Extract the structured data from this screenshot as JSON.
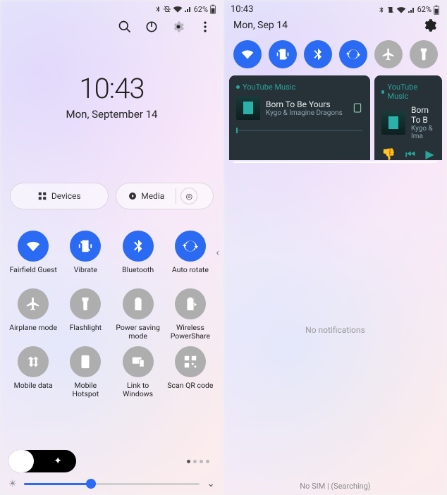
{
  "left": {
    "status": {
      "battery_pct": "62%"
    },
    "clock": {
      "time": "10:43",
      "date": "Mon, September 14"
    },
    "chips": {
      "devices": "Devices",
      "media": "Media"
    },
    "qs": [
      {
        "key": "wifi",
        "label": "Fairfield Guest",
        "on": true
      },
      {
        "key": "vibrate",
        "label": "Vibrate",
        "on": true
      },
      {
        "key": "bluetooth",
        "label": "Bluetooth",
        "on": true
      },
      {
        "key": "autorotate",
        "label": "Auto rotate",
        "on": true
      },
      {
        "key": "airplane",
        "label": "Airplane mode",
        "on": false
      },
      {
        "key": "flashlight",
        "label": "Flashlight",
        "on": false
      },
      {
        "key": "powersave",
        "label": "Power saving mode",
        "on": false
      },
      {
        "key": "powershare",
        "label": "Wireless PowerShare",
        "on": false
      },
      {
        "key": "mobiledata",
        "label": "Mobile data",
        "on": false
      },
      {
        "key": "hotspot",
        "label": "Mobile Hotspot",
        "on": false
      },
      {
        "key": "linkwin",
        "label": "Link to Windows",
        "on": false
      },
      {
        "key": "scanqr",
        "label": "Scan QR code",
        "on": false
      }
    ],
    "brightness_pct": 38
  },
  "right": {
    "status": {
      "time": "10:43",
      "battery_pct": "62%"
    },
    "date": "Mon, Sep 14",
    "qs": [
      {
        "key": "wifi",
        "on": true
      },
      {
        "key": "vibrate",
        "on": true
      },
      {
        "key": "bluetooth",
        "on": true
      },
      {
        "key": "autorotate",
        "on": true
      },
      {
        "key": "airplane",
        "on": false
      },
      {
        "key": "flashlight",
        "on": false
      }
    ],
    "media": {
      "app": "YouTube Music",
      "title": "Born To Be Yours",
      "artist": "Kygo & Imagine Dragons",
      "title2": "Born To B",
      "artist2": "Kygo & Ima"
    },
    "no_notif": "No notifications",
    "sim": "No SIM | (Searching)"
  }
}
